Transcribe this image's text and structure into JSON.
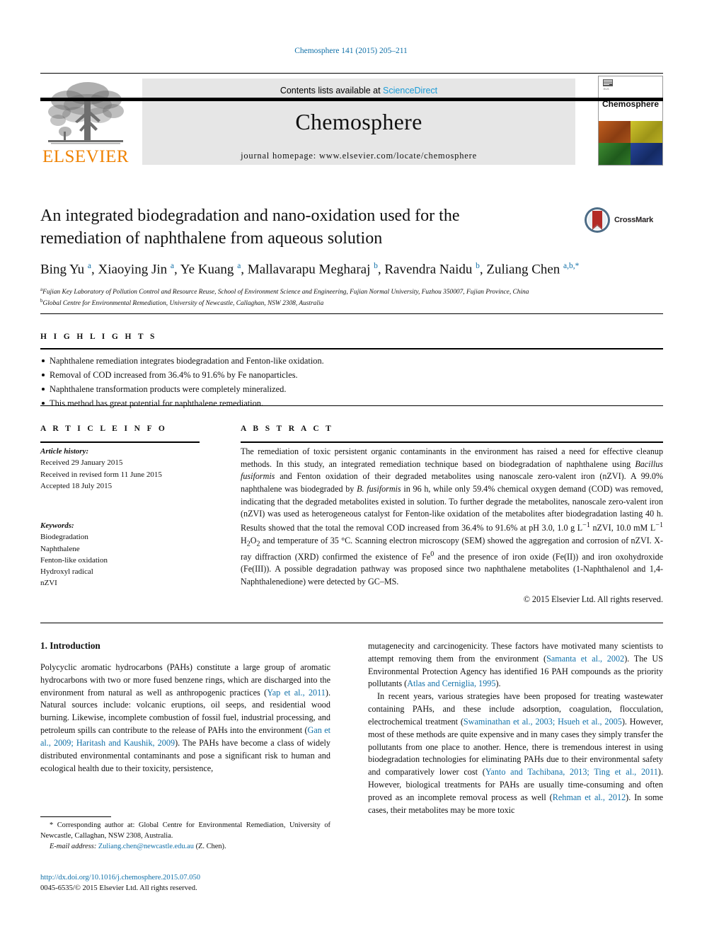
{
  "running_head": "Chemosphere 141 (2015) 205–211",
  "masthead": {
    "contents_prefix": "Contents lists available at ",
    "sciencedirect": "ScienceDirect",
    "journal_name": "Chemosphere",
    "homepage": "journal homepage: www.elsevier.com/locate/chemosphere",
    "publisher": "ELSEVIER",
    "cover_title": "Chemosphere",
    "cover_colors": [
      "#b4541e",
      "#c4bb1e",
      "#2e7d2a",
      "#1c3f8f"
    ],
    "accent_color": "#1a9bd7",
    "elsevier_orange": "#ef8200"
  },
  "article": {
    "title": "An integrated biodegradation and nano-oxidation used for the remediation of naphthalene from aqueous solution",
    "crossmark_label": "CrossMark",
    "authors_html": "Bing Yu <sup>a</sup>, Xiaoying Jin <sup>a</sup>, Ye Kuang <sup>a</sup>, Mallavarapu Megharaj <sup>b</sup>, Ravendra Naidu <sup>b</sup>, Zuliang Chen <sup>a,b,</sup><sup>*</sup>",
    "affiliations": [
      "Fujian Key Laboratory of Pollution Control and Resource Reuse, School of Environment Science and Engineering, Fujian Normal University, Fuzhou 350007, Fujian Province, China",
      "Global Centre for Environmental Remediation, University of Newcastle, Callaghan, NSW 2308, Australia"
    ],
    "affiliation_marks": [
      "a",
      "b"
    ]
  },
  "highlights": {
    "heading": "H I G H L I G H T S",
    "items": [
      "Naphthalene remediation integrates biodegradation and Fenton-like oxidation.",
      "Removal of COD increased from 36.4% to 91.6% by Fe nanoparticles.",
      "Naphthalene transformation products were completely mineralized.",
      "This method has great potential for naphthalene remediation."
    ]
  },
  "article_info": {
    "heading": "A R T I C L E  I N F O",
    "history_label": "Article history:",
    "history": [
      "Received 29 January 2015",
      "Received in revised form 11 June 2015",
      "Accepted 18 July 2015"
    ],
    "keywords_label": "Keywords:",
    "keywords": [
      "Biodegradation",
      "Naphthalene",
      "Fenton-like oxidation",
      "Hydroxyl radical",
      "nZVI"
    ]
  },
  "abstract": {
    "heading": "A B S T R A C T",
    "body_html": "The remediation of toxic persistent organic contaminants in the environment has raised a need for effective cleanup methods. In this study, an integrated remediation technique based on biodegradation of naphthalene using <i>Bacillus fusiformis</i> and Fenton oxidation of their degraded metabolites using nanoscale zero-valent iron (nZVI). A 99.0% naphthalene was biodegraded by <i>B. fusiformis</i> in 96 h, while only 59.4% chemical oxygen demand (COD) was removed, indicating that the degraded metabolites existed in solution. To further degrade the metabolites, nanoscale zero-valent iron (nZVI) was used as heterogeneous catalyst for Fenton-like oxidation of the metabolites after biodegradation lasting 40 h. Results showed that the total the removal COD increased from 36.4% to 91.6% at pH 3.0, 1.0 g L<sup>−1</sup> nZVI, 10.0 mM L<sup>−1</sup> H<sub>2</sub>O<sub>2</sub> and temperature of 35 °C. Scanning electron microscopy (SEM) showed the aggregation and corrosion of nZVI. X-ray diffraction (XRD) confirmed the existence of Fe<sup>0</sup> and the presence of iron oxide (Fe(II)) and iron oxohydroxide (Fe(III)). A possible degradation pathway was proposed since two naphthalene metabolites (1-Naphthalenol and 1,4-Naphthalenedione) were detected by GC–MS.",
    "copyright": "© 2015 Elsevier Ltd. All rights reserved."
  },
  "introduction": {
    "heading": "1. Introduction",
    "left_paragraphs_html": [
      "Polycyclic aromatic hydrocarbons (PAHs) constitute a large group of aromatic hydrocarbons with two or more fused benzene rings, which are discharged into the environment from natural as well as anthropogenic practices (<span class=\"cit\">Yap et al., 2011</span>). Natural sources include: volcanic eruptions, oil seeps, and residential wood burning. Likewise, incomplete combustion of fossil fuel, industrial processing, and petroleum spills can contribute to the release of PAHs into the environment (<span class=\"cit\">Gan et al., 2009; Haritash and Kaushik, 2009</span>). The PAHs have become a class of widely distributed environmental contaminants and pose a significant risk to human and ecological health due to their toxicity, persistence,"
    ],
    "right_paragraphs_html": [
      "mutagenecity and carcinogenicity. These factors have motivated many scientists to attempt removing them from the environment (<span class=\"cit\">Samanta et al., 2002</span>). The US Environmental Protection Agency has identified 16 PAH compounds as the priority pollutants (<span class=\"cit\">Atlas and Cerniglia, 1995</span>).",
      "In recent years, various strategies have been proposed for treating wastewater containing PAHs, and these include adsorption, coagulation, flocculation, electrochemical treatment (<span class=\"cit\">Swaminathan et al., 2003; Hsueh et al., 2005</span>). However, most of these methods are quite expensive and in many cases they simply transfer the pollutants from one place to another. Hence, there is tremendous interest in using biodegradation technologies for eliminating PAHs due to their environmental safety and comparatively lower cost (<span class=\"cit\">Yanto and Tachibana, 2013; Ting et al., 2011</span>). However, biological treatments for PAHs are usually time-consuming and often proved as an incomplete removal process as well (<span class=\"cit\">Rehman et al., 2012</span>). In some cases, their metabolites may be more toxic"
    ]
  },
  "footnotes": {
    "corresponding_html": "* Corresponding author at: Global Centre for Environmental Remediation, University of Newcastle, Callaghan, NSW 2308, Australia.",
    "email_label": "E-mail address:",
    "email": "Zuliang.chen@newcastle.edu.au",
    "email_suffix": "(Z. Chen).",
    "doi": "http://dx.doi.org/10.1016/j.chemosphere.2015.07.050",
    "issn_line": "0045-6535/© 2015 Elsevier Ltd. All rights reserved."
  }
}
